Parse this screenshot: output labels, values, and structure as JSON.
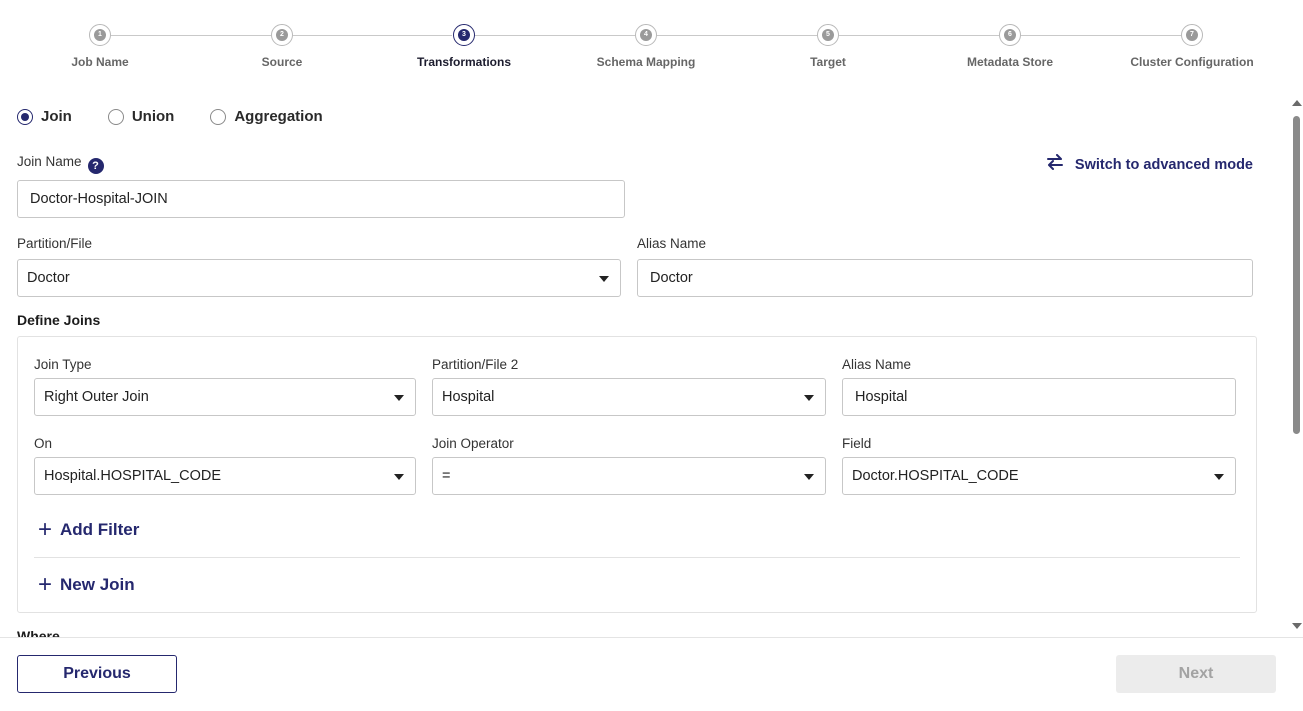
{
  "stepper": {
    "steps": [
      {
        "number": "1",
        "label": "Job Name"
      },
      {
        "number": "2",
        "label": "Source"
      },
      {
        "number": "3",
        "label": "Transformations"
      },
      {
        "number": "4",
        "label": "Schema Mapping"
      },
      {
        "number": "5",
        "label": "Target"
      },
      {
        "number": "6",
        "label": "Metadata Store"
      },
      {
        "number": "7",
        "label": "Cluster Configuration"
      }
    ],
    "active_step": 3
  },
  "transform_type": {
    "options": [
      "Join",
      "Union",
      "Aggregation"
    ],
    "selected": "Join"
  },
  "join_name": {
    "label": "Join Name",
    "help_icon": "?",
    "value": "Doctor-Hospital-JOIN"
  },
  "advanced_mode": {
    "icon": "swap-arrows-icon",
    "label": "Switch to advanced mode"
  },
  "partition": {
    "label": "Partition/File",
    "value": "Doctor"
  },
  "alias": {
    "label": "Alias Name",
    "value": "Doctor"
  },
  "define_joins": {
    "title": "Define Joins",
    "join_type": {
      "label": "Join Type",
      "value": "Right Outer Join"
    },
    "partition2": {
      "label": "Partition/File 2",
      "value": "Hospital"
    },
    "alias2": {
      "label": "Alias Name",
      "value": "Hospital"
    },
    "on": {
      "label": "On",
      "value": "Hospital.HOSPITAL_CODE"
    },
    "operator": {
      "label": "Join Operator",
      "value": "="
    },
    "field": {
      "label": "Field",
      "value": "Doctor.HOSPITAL_CODE"
    },
    "add_filter": "Add Filter",
    "new_join": "New Join"
  },
  "where": {
    "title": "Where"
  },
  "footer": {
    "previous": "Previous",
    "next": "Next"
  },
  "colors": {
    "accent": "#25286e",
    "disabled_bg": "#ececec",
    "disabled_text": "#a3a3a3"
  }
}
